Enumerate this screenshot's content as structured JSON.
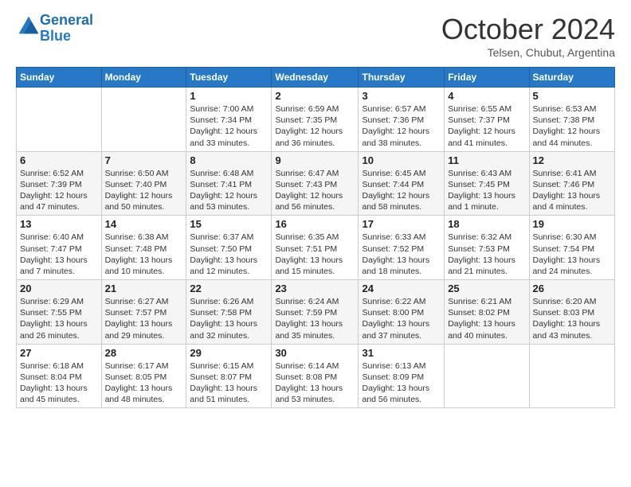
{
  "logo": {
    "line1": "General",
    "line2": "Blue"
  },
  "title": "October 2024",
  "subtitle": "Telsen, Chubut, Argentina",
  "weekdays": [
    "Sunday",
    "Monday",
    "Tuesday",
    "Wednesday",
    "Thursday",
    "Friday",
    "Saturday"
  ],
  "weeks": [
    [
      {
        "day": "",
        "info": ""
      },
      {
        "day": "",
        "info": ""
      },
      {
        "day": "1",
        "info": "Sunrise: 7:00 AM\nSunset: 7:34 PM\nDaylight: 12 hours\nand 33 minutes."
      },
      {
        "day": "2",
        "info": "Sunrise: 6:59 AM\nSunset: 7:35 PM\nDaylight: 12 hours\nand 36 minutes."
      },
      {
        "day": "3",
        "info": "Sunrise: 6:57 AM\nSunset: 7:36 PM\nDaylight: 12 hours\nand 38 minutes."
      },
      {
        "day": "4",
        "info": "Sunrise: 6:55 AM\nSunset: 7:37 PM\nDaylight: 12 hours\nand 41 minutes."
      },
      {
        "day": "5",
        "info": "Sunrise: 6:53 AM\nSunset: 7:38 PM\nDaylight: 12 hours\nand 44 minutes."
      }
    ],
    [
      {
        "day": "6",
        "info": "Sunrise: 6:52 AM\nSunset: 7:39 PM\nDaylight: 12 hours\nand 47 minutes."
      },
      {
        "day": "7",
        "info": "Sunrise: 6:50 AM\nSunset: 7:40 PM\nDaylight: 12 hours\nand 50 minutes."
      },
      {
        "day": "8",
        "info": "Sunrise: 6:48 AM\nSunset: 7:41 PM\nDaylight: 12 hours\nand 53 minutes."
      },
      {
        "day": "9",
        "info": "Sunrise: 6:47 AM\nSunset: 7:43 PM\nDaylight: 12 hours\nand 56 minutes."
      },
      {
        "day": "10",
        "info": "Sunrise: 6:45 AM\nSunset: 7:44 PM\nDaylight: 12 hours\nand 58 minutes."
      },
      {
        "day": "11",
        "info": "Sunrise: 6:43 AM\nSunset: 7:45 PM\nDaylight: 13 hours\nand 1 minute."
      },
      {
        "day": "12",
        "info": "Sunrise: 6:41 AM\nSunset: 7:46 PM\nDaylight: 13 hours\nand 4 minutes."
      }
    ],
    [
      {
        "day": "13",
        "info": "Sunrise: 6:40 AM\nSunset: 7:47 PM\nDaylight: 13 hours\nand 7 minutes."
      },
      {
        "day": "14",
        "info": "Sunrise: 6:38 AM\nSunset: 7:48 PM\nDaylight: 13 hours\nand 10 minutes."
      },
      {
        "day": "15",
        "info": "Sunrise: 6:37 AM\nSunset: 7:50 PM\nDaylight: 13 hours\nand 12 minutes."
      },
      {
        "day": "16",
        "info": "Sunrise: 6:35 AM\nSunset: 7:51 PM\nDaylight: 13 hours\nand 15 minutes."
      },
      {
        "day": "17",
        "info": "Sunrise: 6:33 AM\nSunset: 7:52 PM\nDaylight: 13 hours\nand 18 minutes."
      },
      {
        "day": "18",
        "info": "Sunrise: 6:32 AM\nSunset: 7:53 PM\nDaylight: 13 hours\nand 21 minutes."
      },
      {
        "day": "19",
        "info": "Sunrise: 6:30 AM\nSunset: 7:54 PM\nDaylight: 13 hours\nand 24 minutes."
      }
    ],
    [
      {
        "day": "20",
        "info": "Sunrise: 6:29 AM\nSunset: 7:55 PM\nDaylight: 13 hours\nand 26 minutes."
      },
      {
        "day": "21",
        "info": "Sunrise: 6:27 AM\nSunset: 7:57 PM\nDaylight: 13 hours\nand 29 minutes."
      },
      {
        "day": "22",
        "info": "Sunrise: 6:26 AM\nSunset: 7:58 PM\nDaylight: 13 hours\nand 32 minutes."
      },
      {
        "day": "23",
        "info": "Sunrise: 6:24 AM\nSunset: 7:59 PM\nDaylight: 13 hours\nand 35 minutes."
      },
      {
        "day": "24",
        "info": "Sunrise: 6:22 AM\nSunset: 8:00 PM\nDaylight: 13 hours\nand 37 minutes."
      },
      {
        "day": "25",
        "info": "Sunrise: 6:21 AM\nSunset: 8:02 PM\nDaylight: 13 hours\nand 40 minutes."
      },
      {
        "day": "26",
        "info": "Sunrise: 6:20 AM\nSunset: 8:03 PM\nDaylight: 13 hours\nand 43 minutes."
      }
    ],
    [
      {
        "day": "27",
        "info": "Sunrise: 6:18 AM\nSunset: 8:04 PM\nDaylight: 13 hours\nand 45 minutes."
      },
      {
        "day": "28",
        "info": "Sunrise: 6:17 AM\nSunset: 8:05 PM\nDaylight: 13 hours\nand 48 minutes."
      },
      {
        "day": "29",
        "info": "Sunrise: 6:15 AM\nSunset: 8:07 PM\nDaylight: 13 hours\nand 51 minutes."
      },
      {
        "day": "30",
        "info": "Sunrise: 6:14 AM\nSunset: 8:08 PM\nDaylight: 13 hours\nand 53 minutes."
      },
      {
        "day": "31",
        "info": "Sunrise: 6:13 AM\nSunset: 8:09 PM\nDaylight: 13 hours\nand 56 minutes."
      },
      {
        "day": "",
        "info": ""
      },
      {
        "day": "",
        "info": ""
      }
    ]
  ]
}
